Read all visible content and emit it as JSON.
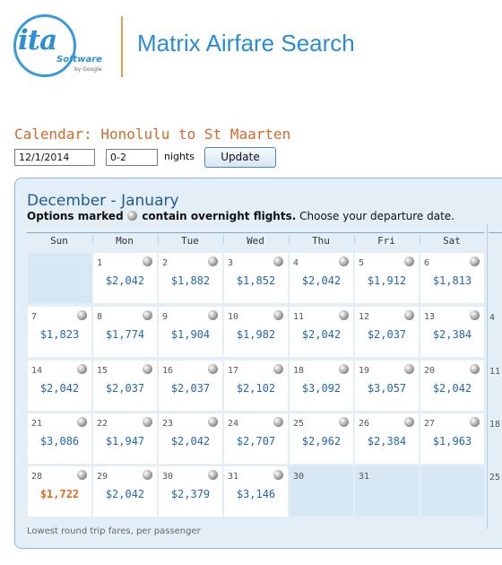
{
  "header": {
    "logo": {
      "main": "ita",
      "sub": "Software",
      "byline": "by Google"
    },
    "title": "Matrix Airfare Search"
  },
  "query": {
    "calendar_title": "Calendar: Honolulu to St Maarten",
    "date_value": "12/1/2014",
    "nights_value": "0-2",
    "nights_label": "nights",
    "update_label": "Update"
  },
  "calendar": {
    "title": "December - January",
    "options_bold_prefix": "Options marked",
    "options_bold_suffix": "contain overnight flights.",
    "options_rest": "Choose your departure date.",
    "weekdays": [
      "Sun",
      "Mon",
      "Tue",
      "Wed",
      "Thu",
      "Fri",
      "Sat"
    ],
    "weeks": [
      [
        {
          "day": "",
          "price": ""
        },
        {
          "day": "1",
          "price": "$2,042"
        },
        {
          "day": "2",
          "price": "$1,882"
        },
        {
          "day": "3",
          "price": "$1,852"
        },
        {
          "day": "4",
          "price": "$2,042"
        },
        {
          "day": "5",
          "price": "$1,912"
        },
        {
          "day": "6",
          "price": "$1,813"
        }
      ],
      [
        {
          "day": "7",
          "price": "$1,823"
        },
        {
          "day": "8",
          "price": "$1,774"
        },
        {
          "day": "9",
          "price": "$1,904"
        },
        {
          "day": "10",
          "price": "$1,982"
        },
        {
          "day": "11",
          "price": "$2,042"
        },
        {
          "day": "12",
          "price": "$2,037"
        },
        {
          "day": "13",
          "price": "$2,384"
        }
      ],
      [
        {
          "day": "14",
          "price": "$2,042"
        },
        {
          "day": "15",
          "price": "$2,037"
        },
        {
          "day": "16",
          "price": "$2,037"
        },
        {
          "day": "17",
          "price": "$2,102"
        },
        {
          "day": "18",
          "price": "$3,092"
        },
        {
          "day": "19",
          "price": "$3,057"
        },
        {
          "day": "20",
          "price": "$2,042"
        }
      ],
      [
        {
          "day": "21",
          "price": "$3,086"
        },
        {
          "day": "22",
          "price": "$1,947"
        },
        {
          "day": "23",
          "price": "$2,042"
        },
        {
          "day": "24",
          "price": "$2,707"
        },
        {
          "day": "25",
          "price": "$2,962"
        },
        {
          "day": "26",
          "price": "$2,384"
        },
        {
          "day": "27",
          "price": "$1,963"
        }
      ],
      [
        {
          "day": "28",
          "price": "$1,722",
          "lowest": true
        },
        {
          "day": "29",
          "price": "$2,042"
        },
        {
          "day": "30",
          "price": "$2,379"
        },
        {
          "day": "31",
          "price": "$3,146"
        },
        {
          "day": "30",
          "price": ""
        },
        {
          "day": "31",
          "price": ""
        },
        {
          "day": "",
          "price": ""
        }
      ]
    ],
    "next_month_peek": [
      "4",
      "11",
      "18",
      "25"
    ],
    "footer": "Lowest round trip fares, per passenger",
    "colors": {
      "price": "#2468a8",
      "lowest_price": "#e06a1e",
      "accent": "#cf6a2b"
    }
  }
}
